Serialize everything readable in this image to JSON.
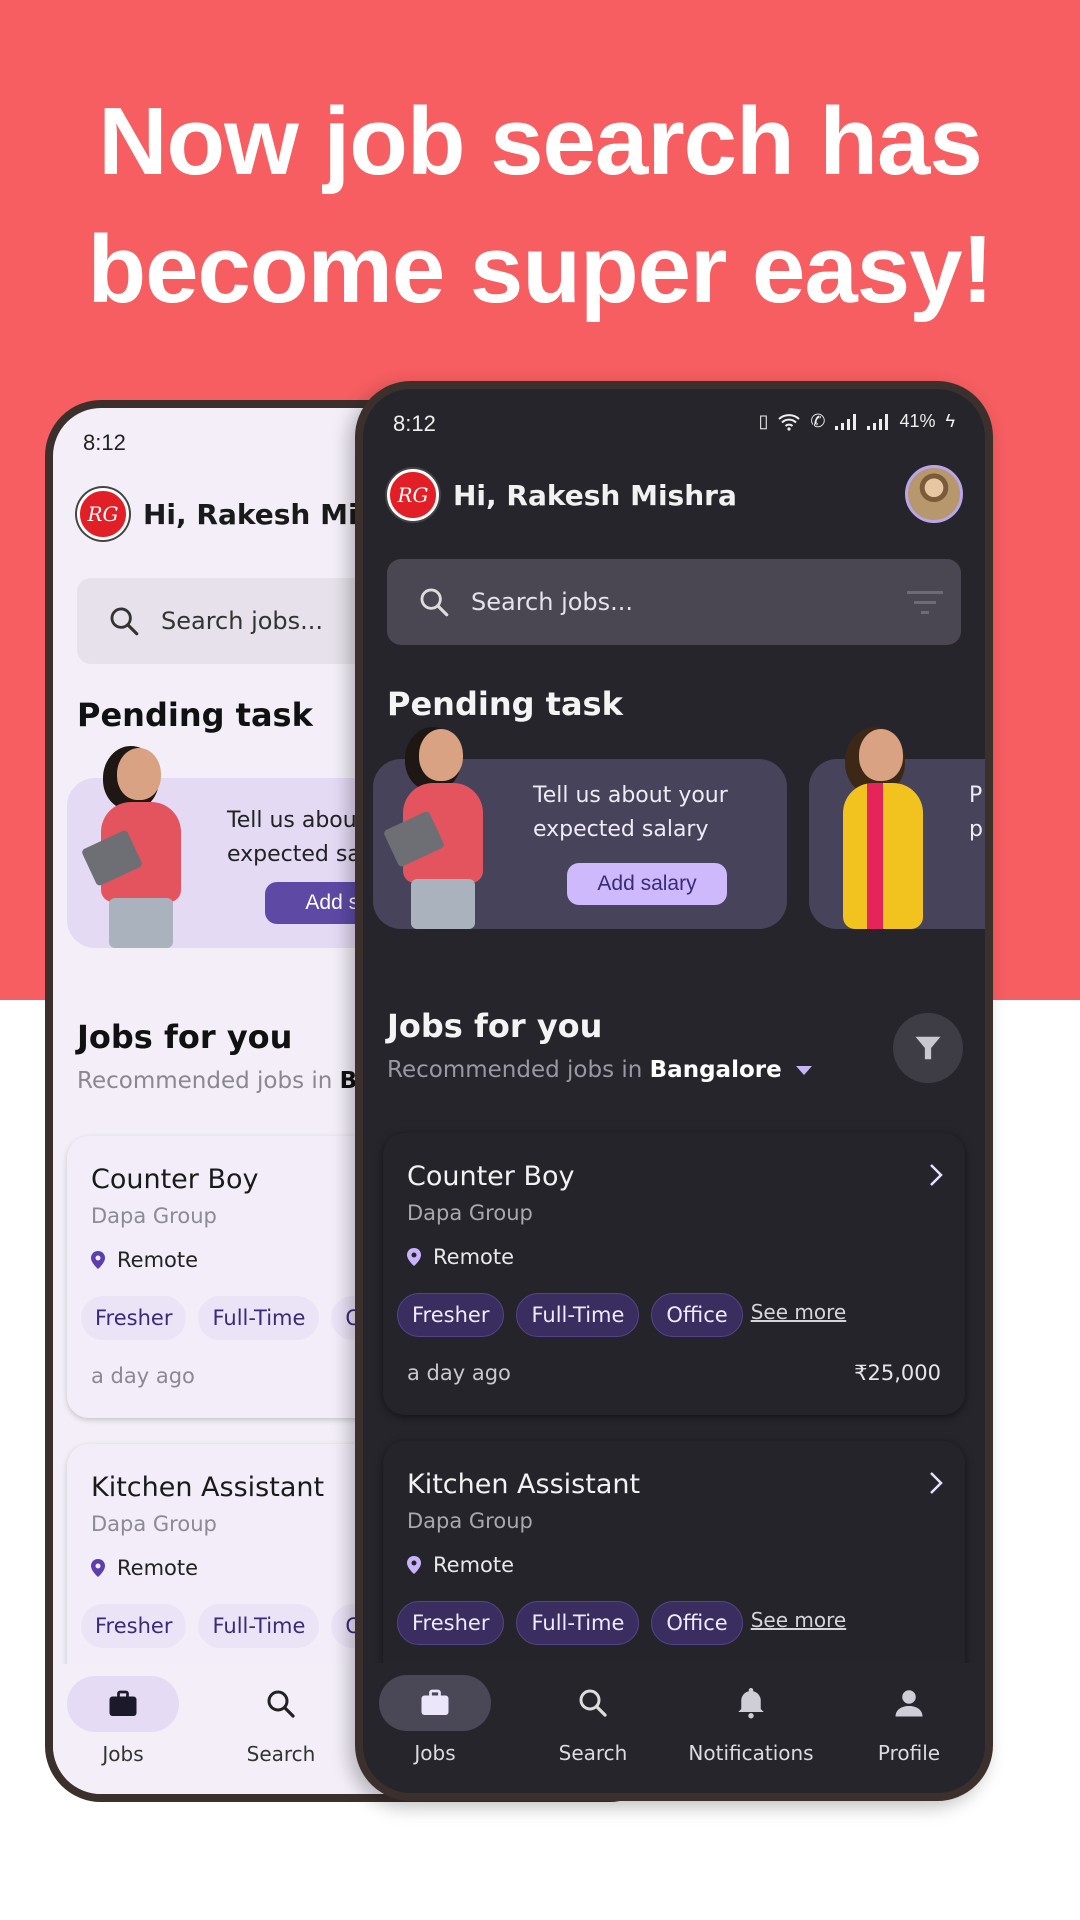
{
  "hero": {
    "headline_line1": "Now job search has",
    "headline_line2": "become super easy!",
    "bg_color": "#f65e61"
  },
  "app": {
    "status_time": "8:12",
    "status_battery": "41%",
    "logo_text": "RG",
    "greeting": "Hi, Rakesh Mishra",
    "search_placeholder": "Search jobs...",
    "pending_title": "Pending task",
    "pending_tasks": [
      {
        "text_line1": "Tell us about your",
        "text_line2": "expected salary",
        "button": "Add salary"
      },
      {
        "text_line1": "P",
        "text_line2": "p",
        "button": ""
      }
    ],
    "jobs_title": "Jobs for you",
    "jobs_subtitle_prefix": "Recommended jobs in",
    "jobs_city": "Bangalore",
    "jobs": [
      {
        "title": "Counter Boy",
        "company": "Dapa Group",
        "location": "Remote",
        "tags": [
          "Fresher",
          "Full-Time",
          "Office"
        ],
        "see_more": "See more",
        "posted": "a day ago",
        "salary": "₹25,000"
      },
      {
        "title": "Kitchen Assistant",
        "company": "Dapa Group",
        "location": "Remote",
        "tags": [
          "Fresher",
          "Full-Time",
          "Office"
        ],
        "see_more": "See more",
        "posted": "",
        "salary": ""
      }
    ],
    "nav": [
      {
        "label": "Jobs",
        "icon": "briefcase-icon",
        "active": true
      },
      {
        "label": "Search",
        "icon": "search-icon",
        "active": false
      },
      {
        "label": "Notifications",
        "icon": "bell-icon",
        "active": false
      },
      {
        "label": "Profile",
        "icon": "person-icon",
        "active": false
      }
    ],
    "accent_light": "#5e4aa5",
    "accent_dark": "#cdb9fb"
  }
}
